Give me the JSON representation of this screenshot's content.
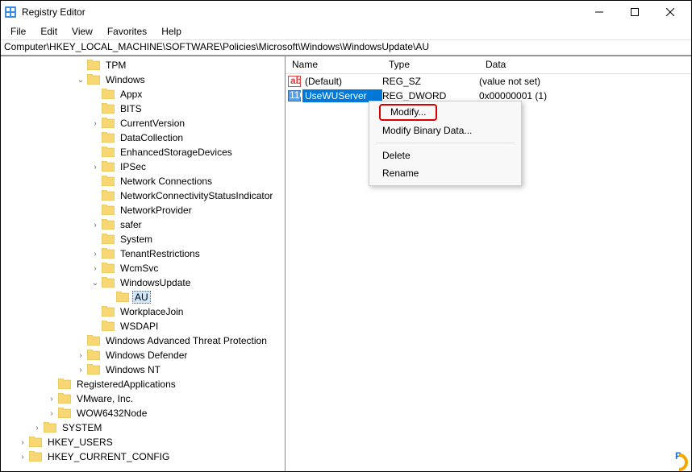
{
  "window": {
    "title": "Registry Editor"
  },
  "menu": {
    "file": "File",
    "edit": "Edit",
    "view": "View",
    "favorites": "Favorites",
    "help": "Help"
  },
  "address": "Computer\\HKEY_LOCAL_MACHINE\\SOFTWARE\\Policies\\Microsoft\\Windows\\WindowsUpdate\\AU",
  "tree": [
    {
      "lvl": 5,
      "exp": "",
      "label": "TPM"
    },
    {
      "lvl": 5,
      "exp": "v",
      "label": "Windows"
    },
    {
      "lvl": 6,
      "exp": "",
      "label": "Appx"
    },
    {
      "lvl": 6,
      "exp": "",
      "label": "BITS"
    },
    {
      "lvl": 6,
      "exp": ">",
      "label": "CurrentVersion"
    },
    {
      "lvl": 6,
      "exp": "",
      "label": "DataCollection"
    },
    {
      "lvl": 6,
      "exp": "",
      "label": "EnhancedStorageDevices"
    },
    {
      "lvl": 6,
      "exp": ">",
      "label": "IPSec"
    },
    {
      "lvl": 6,
      "exp": "",
      "label": "Network Connections"
    },
    {
      "lvl": 6,
      "exp": "",
      "label": "NetworkConnectivityStatusIndicator"
    },
    {
      "lvl": 6,
      "exp": "",
      "label": "NetworkProvider"
    },
    {
      "lvl": 6,
      "exp": ">",
      "label": "safer"
    },
    {
      "lvl": 6,
      "exp": "",
      "label": "System"
    },
    {
      "lvl": 6,
      "exp": ">",
      "label": "TenantRestrictions"
    },
    {
      "lvl": 6,
      "exp": ">",
      "label": "WcmSvc"
    },
    {
      "lvl": 6,
      "exp": "v",
      "label": "WindowsUpdate"
    },
    {
      "lvl": 7,
      "exp": "",
      "label": "AU",
      "selected": true
    },
    {
      "lvl": 6,
      "exp": "",
      "label": "WorkplaceJoin"
    },
    {
      "lvl": 6,
      "exp": "",
      "label": "WSDAPI"
    },
    {
      "lvl": 5,
      "exp": "",
      "label": "Windows Advanced Threat Protection"
    },
    {
      "lvl": 5,
      "exp": ">",
      "label": "Windows Defender"
    },
    {
      "lvl": 5,
      "exp": ">",
      "label": "Windows NT"
    },
    {
      "lvl": 3,
      "exp": "",
      "label": "RegisteredApplications"
    },
    {
      "lvl": 3,
      "exp": ">",
      "label": "VMware, Inc."
    },
    {
      "lvl": 3,
      "exp": ">",
      "label": "WOW6432Node"
    },
    {
      "lvl": 2,
      "exp": ">",
      "label": "SYSTEM"
    },
    {
      "lvl": 1,
      "exp": ">",
      "label": "HKEY_USERS"
    },
    {
      "lvl": 1,
      "exp": ">",
      "label": "HKEY_CURRENT_CONFIG"
    }
  ],
  "cols": {
    "name": "Name",
    "type": "Type",
    "data": "Data"
  },
  "values": [
    {
      "icon": "ab",
      "name": "(Default)",
      "type": "REG_SZ",
      "data": "(value not set)",
      "selected": false
    },
    {
      "icon": "bin",
      "name": "UseWUServer",
      "type": "REG_DWORD",
      "data": "0x00000001 (1)",
      "selected": true
    }
  ],
  "ctx": {
    "modify": "Modify...",
    "modbin": "Modify Binary Data...",
    "delete": "Delete",
    "rename": "Rename"
  },
  "watermark": "P"
}
